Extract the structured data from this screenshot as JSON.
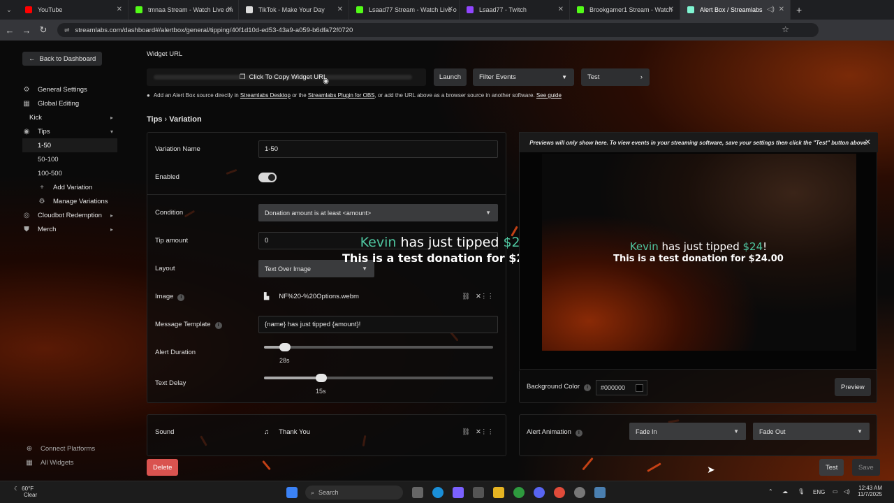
{
  "browser": {
    "tabs": [
      {
        "label": "YouTube",
        "color": "#ff0000"
      },
      {
        "label": "tmnaa Stream - Watch Live on",
        "color": "#53fc18"
      },
      {
        "label": "TikTok - Make Your Day",
        "color": "#111111"
      },
      {
        "label": "Lsaad77 Stream - Watch Live o",
        "color": "#53fc18"
      },
      {
        "label": "Lsaad77 - Twitch",
        "color": "#9146ff"
      },
      {
        "label": "Brookgamer1 Stream - Watch",
        "color": "#53fc18"
      },
      {
        "label": "Alert Box / Streamlabs",
        "color": "#80f5d2",
        "active": true
      }
    ],
    "url": "streamlabs.com/dashboard#/alertbox/general/tipping/40f1d10d-ed53-43a9-a059-b6dfa72f0720"
  },
  "sidebar": {
    "back": "Back to Dashboard",
    "items": [
      {
        "label": "General Settings",
        "icon": "gear-icon"
      },
      {
        "label": "Global Editing",
        "icon": "grid-icon"
      },
      {
        "label": "Kick",
        "icon": "",
        "arrow": "▸"
      },
      {
        "label": "Tips",
        "icon": "coin-icon",
        "arrow": "▾"
      }
    ],
    "tips_sub": [
      "1-50",
      "50-100",
      "100-500"
    ],
    "more": [
      {
        "label": "Add Variation",
        "icon": "plus-icon"
      },
      {
        "label": "Manage Variations",
        "icon": "gear-icon"
      },
      {
        "label": "Cloudbot Redemption",
        "icon": "bot-icon",
        "arrow": "▸"
      },
      {
        "label": "Merch",
        "icon": "shirt-icon",
        "arrow": "▸"
      }
    ],
    "bottom": [
      "Connect Platforms",
      "All Widgets"
    ]
  },
  "widget": {
    "title": "Widget URL",
    "copy": "Click To Copy Widget URL",
    "launch": "Launch",
    "filter": "Filter Events",
    "test": "Test",
    "hint_pre": "Add an Alert Box source directly in",
    "hint_link1": "Streamlabs Desktop",
    "hint_mid": "or the",
    "hint_link2": "Streamlabs Plugin for OBS",
    "hint_post": ", or add the URL above as a browser source in another software.",
    "hint_link3": "See guide"
  },
  "breadcrumb": {
    "a": "Tips",
    "sep": "›",
    "b": "Variation"
  },
  "form": {
    "variation_name_label": "Variation Name",
    "variation_name": "1-50",
    "enabled_label": "Enabled",
    "condition_label": "Condition",
    "condition": "Donation amount is at least <amount>",
    "tip_amount_label": "Tip amount",
    "tip_amount": "0",
    "layout_label": "Layout",
    "layout": "Text Over Image",
    "image_label": "Image",
    "image_file": "NF%20-%20Options.webm",
    "message_label": "Message Template",
    "message": "{name} has just tipped {amount}!",
    "duration_label": "Alert Duration",
    "duration": "28s",
    "duration_fraction": 0.09,
    "delay_label": "Text Delay",
    "delay": "15s",
    "delay_fraction": 0.25,
    "sound_label": "Sound",
    "sound": "Thank You"
  },
  "overlay": {
    "name": "Kevin",
    "mid": " has just tipped ",
    "amount": "$24",
    "end": "!",
    "line2": "This is a test donation for $24.00"
  },
  "preview": {
    "note": "Previews will only show here. To view events in your streaming software, save your settings then click the \"Test\" button above.",
    "bg_label": "Background Color",
    "bg_value": "#000000",
    "preview_btn": "Preview",
    "anim_label": "Alert Animation",
    "anim_in": "Fade In",
    "anim_out": "Fade Out"
  },
  "footer": {
    "delete": "Delete",
    "test": "Test",
    "save": "Save"
  },
  "taskbar": {
    "weather_temp": "60°F",
    "weather": "Clear",
    "search": "Search",
    "lang": "ENG",
    "time": "12:43 AM",
    "date": "11/7/2025"
  },
  "colors": {
    "accent": "#4fc6a0",
    "danger": "#d9534f",
    "panel": "#0c0c0c"
  }
}
